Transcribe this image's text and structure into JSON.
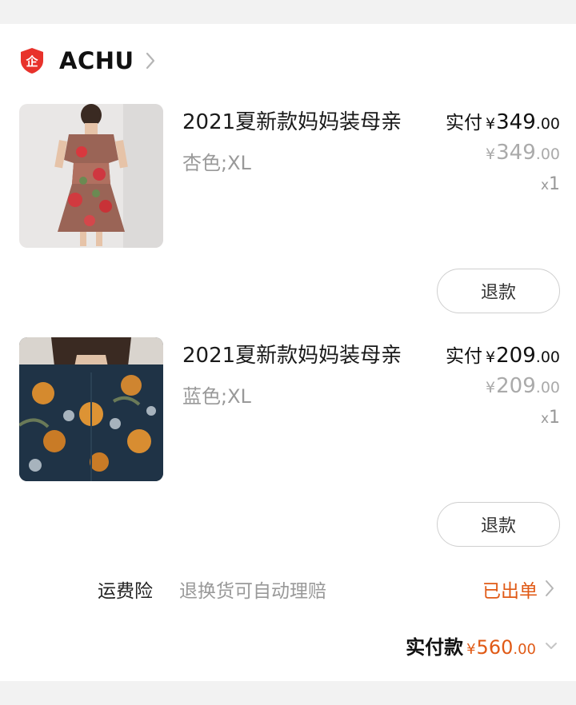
{
  "shop": {
    "name": "ACHU",
    "badge_icon": "enterprise-shield-icon",
    "badge_glyph": "企"
  },
  "items": [
    {
      "title": "2021夏新款妈妈装母亲",
      "sku": "杏色;XL",
      "paid_label": "实付",
      "currency": "¥",
      "paid_int": "349",
      "paid_dec": ".00",
      "orig_int": "349",
      "orig_dec": ".00",
      "qty_x": "x",
      "qty": "1",
      "refund_label": "退款"
    },
    {
      "title": "2021夏新款妈妈装母亲",
      "sku": "蓝色;XL",
      "paid_label": "实付",
      "currency": "¥",
      "paid_int": "209",
      "paid_dec": ".00",
      "orig_int": "209",
      "orig_dec": ".00",
      "qty_x": "x",
      "qty": "1",
      "refund_label": "退款"
    }
  ],
  "insurance": {
    "label": "运费险",
    "desc": "退换货可自动理赔",
    "status": "已出单"
  },
  "total": {
    "label": "实付款",
    "currency": "¥",
    "int": "560",
    "dec": ".00"
  },
  "colors": {
    "accent": "#e05a16",
    "badge_red": "#e8322b",
    "muted": "#999999"
  }
}
